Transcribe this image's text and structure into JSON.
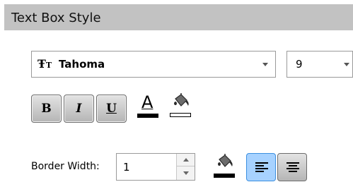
{
  "panel": {
    "title": "Text Box Style"
  },
  "font": {
    "family_value": "Tahoma",
    "size_value": "9",
    "font_icon": "truetype-font-icon",
    "dropdown_icon": "chevron-down-icon"
  },
  "format_buttons": {
    "bold_label": "B",
    "italic_label": "I",
    "underline_label": "U",
    "font_color_label": "A",
    "font_color": "#000000",
    "background_color": "#ffffff",
    "background_color_icon": "paint-bucket-icon"
  },
  "border": {
    "width_label": "Border Width:",
    "width_value": "1",
    "border_color": "#000000",
    "border_color_icon": "paint-bucket-icon"
  },
  "alignment": {
    "left_icon": "align-left-icon",
    "center_icon": "align-center-icon",
    "selected": "left",
    "selected_color": "#a7d2ff"
  }
}
